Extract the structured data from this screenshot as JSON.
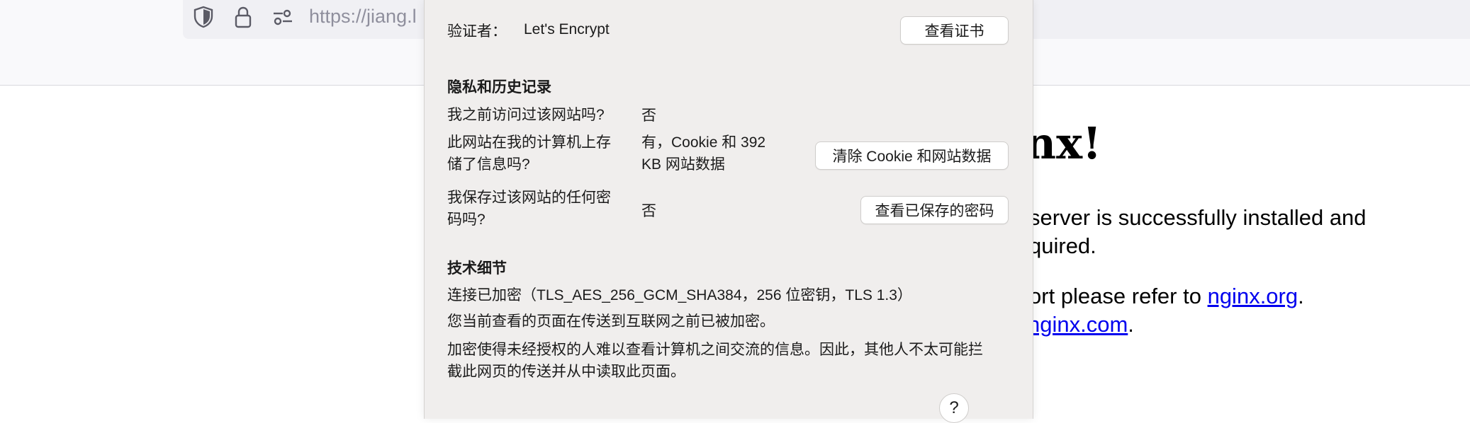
{
  "browser": {
    "url": "https://jiang.l",
    "icons": [
      "shield-icon",
      "lock-icon",
      "permissions-icon"
    ]
  },
  "page": {
    "title_fragment": "nx!",
    "para1_line1": " server is successfully installed and",
    "para1_line2": "quired.",
    "para2_line1_prefix": "ort please refer to ",
    "para2_line1_link": "nginx.org",
    "para2_line1_suffix": ".",
    "para2_line2_link": "nginx.com",
    "para2_line2_suffix": "."
  },
  "panel": {
    "verifier_label": "验证者：",
    "verifier_value": "Let's Encrypt",
    "view_cert_button": "查看证书",
    "privacy_heading": "隐私和历史记录",
    "visited_question": "我之前访问过该网站吗?",
    "visited_answer": "否",
    "stored_question_l1": "此网站在我的计算机上存",
    "stored_question_l2": "储了信息吗?",
    "stored_answer_l1": "有，Cookie 和 392",
    "stored_answer_l2": "KB 网站数据",
    "clear_button": "清除 Cookie 和网站数据",
    "password_question_l1": "我保存过该网站的任何密",
    "password_question_l2": "码吗?",
    "password_answer": "否",
    "view_passwords_button": "查看已保存的密码",
    "tech_heading": "技术细节",
    "tech_line1": "连接已加密（TLS_AES_256_GCM_SHA384，256 位密钥，TLS 1.3）",
    "tech_line2": "您当前查看的页面在传送到互联网之前已被加密。",
    "tech_line3_l1": "加密使得未经授权的人难以查看计算机之间交流的信息。因此，其他人不太可能拦",
    "tech_line3_l2": "截此网页的传送并从中读取此页面。",
    "help_button": "?"
  }
}
